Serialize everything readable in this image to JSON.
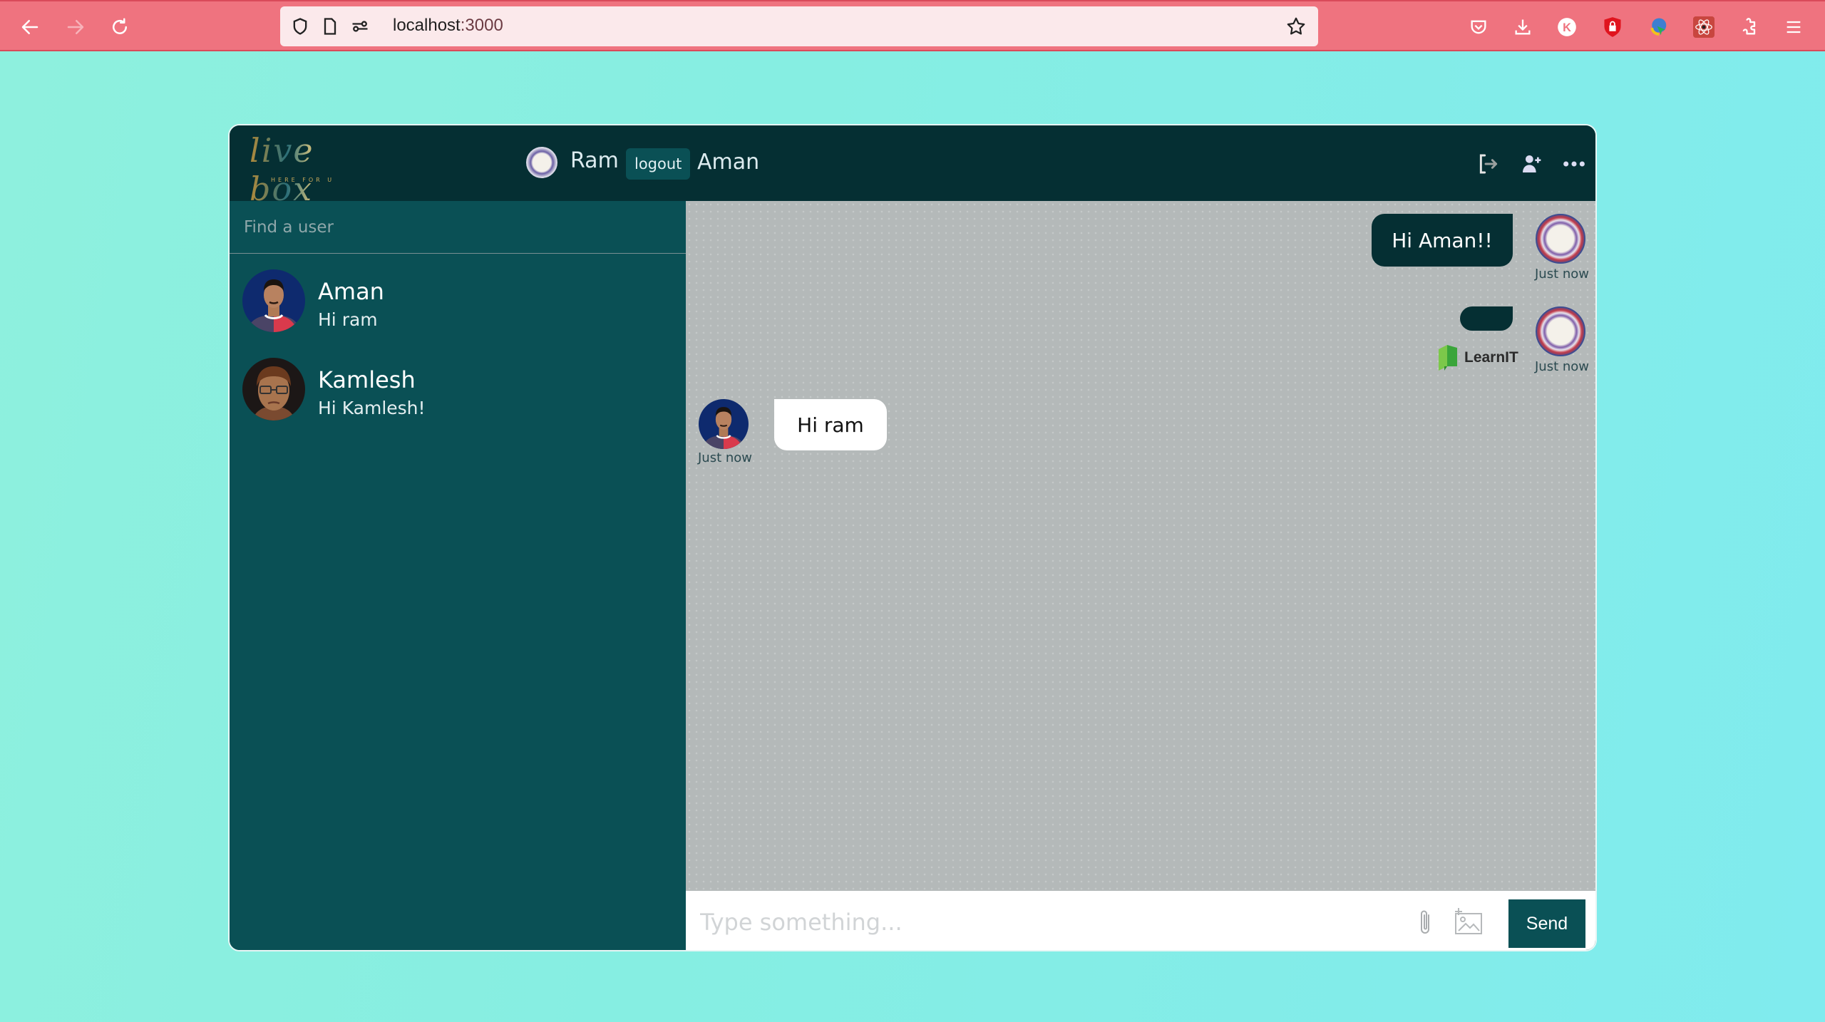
{
  "browser": {
    "url_host": "localhost",
    "url_port": ":3000",
    "icons": [
      "back-icon",
      "forward-icon",
      "reload-icon",
      "shield-icon",
      "page-icon",
      "site-settings-icon",
      "bookmark-star-icon",
      "pocket-icon",
      "downloads-icon",
      "k-extension-icon",
      "lock-shield-extension-icon",
      "idm-extension-icon",
      "react-devtools-icon",
      "extensions-icon",
      "menu-icon"
    ]
  },
  "app": {
    "logo_text": "live box",
    "logo_tagline": "HERE FOR U",
    "current_user": {
      "name": "Ram"
    },
    "logout_label": "logout",
    "chat_with": "Aman",
    "header_icons": [
      "sign-out-icon",
      "add-user-icon",
      "more-options-icon"
    ]
  },
  "sidebar": {
    "search_placeholder": "Find a user",
    "users": [
      {
        "name": "Aman",
        "last_message": "Hi ram"
      },
      {
        "name": "Kamlesh",
        "last_message": "Hi Kamlesh!"
      }
    ]
  },
  "chat": {
    "messages": [
      {
        "owner": "me",
        "text": "Hi Aman!!",
        "time": "Just now"
      },
      {
        "owner": "me",
        "text": "",
        "image_label": "LearnIT",
        "time": "Just now"
      },
      {
        "owner": "Aman",
        "text": "Hi ram",
        "time": "Just now"
      }
    ]
  },
  "input": {
    "placeholder": "Type something...",
    "value": "",
    "send_label": "Send"
  },
  "colors": {
    "browser_bar": "#ef737f",
    "header": "#052f33",
    "sidebar": "#0a5055",
    "chat_bg": "#b4b9b9",
    "outgoing_bubble": "#052f33",
    "incoming_bubble": "#ffffff",
    "send_button": "#0a5055"
  }
}
